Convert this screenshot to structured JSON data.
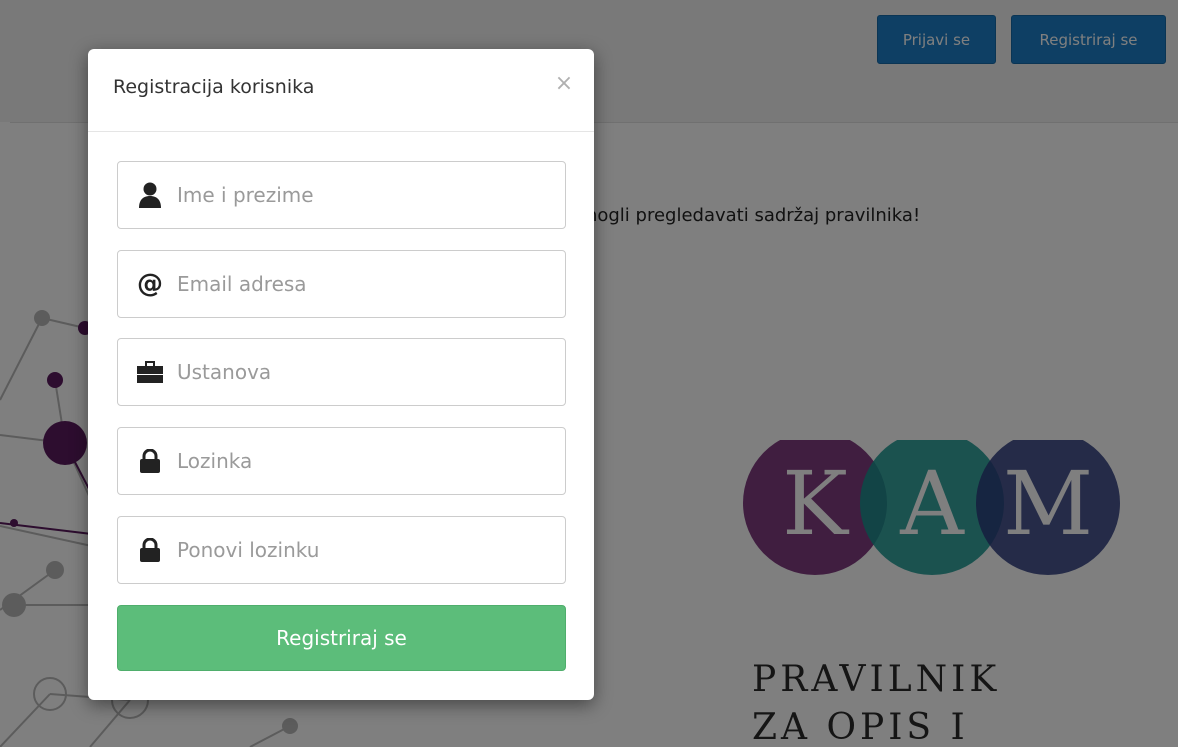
{
  "header": {
    "login_label": "Prijavi se",
    "register_label": "Registriraj se"
  },
  "page": {
    "intro_text_visible": "mogli pregledavati sadržaj pravilnika!",
    "logo_letters": [
      "K",
      "A",
      "M"
    ],
    "logo_title_line1": "PRAVILNIK",
    "logo_title_line2": "ZA OPIS I"
  },
  "modal": {
    "title": "Registracija korisnika",
    "close_symbol": "×",
    "fields": [
      {
        "icon": "user-icon",
        "placeholder": "Ime i prezime",
        "value": ""
      },
      {
        "icon": "at-icon",
        "placeholder": "Email adresa",
        "value": ""
      },
      {
        "icon": "briefcase-icon",
        "placeholder": "Ustanova",
        "value": ""
      },
      {
        "icon": "lock-icon",
        "placeholder": "Lozinka",
        "value": ""
      },
      {
        "icon": "lock-icon",
        "placeholder": "Ponovi lozinku",
        "value": ""
      }
    ],
    "submit_label": "Registriraj se"
  },
  "colors": {
    "primary_blue": "#1c7fc9",
    "success_green": "#5cbd7a",
    "logo_purple": "#6a1b6b",
    "logo_teal": "#14958e",
    "logo_navy": "#2c3a7c",
    "overlay": "rgba(0,0,0,0.5)"
  }
}
